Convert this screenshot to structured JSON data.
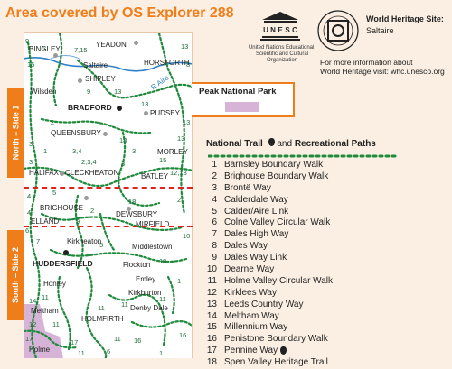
{
  "title": "Area covered by OS Explorer 288",
  "side_tabs": {
    "north": "North – Side 1",
    "south": "South – Side 2"
  },
  "map": {
    "places": [
      {
        "id": "bingley",
        "name": "BINGLEY"
      },
      {
        "id": "yeadon",
        "name": "YEADON"
      },
      {
        "id": "saltaire",
        "name": "Saltaire"
      },
      {
        "id": "horsforth",
        "name": "HORSFORTH"
      },
      {
        "id": "shipley",
        "name": "SHIPLEY"
      },
      {
        "id": "wilsden",
        "name": "Wilsden"
      },
      {
        "id": "river_aire",
        "name": "R Aire"
      },
      {
        "id": "bradford",
        "name": "BRADFORD"
      },
      {
        "id": "pudsey",
        "name": "PUDSEY"
      },
      {
        "id": "queensbury",
        "name": "QUEENSBURY"
      },
      {
        "id": "morley",
        "name": "MORLEY"
      },
      {
        "id": "halifax",
        "name": "HALIFAX"
      },
      {
        "id": "cleckheaton",
        "name": "CLECKHEATON"
      },
      {
        "id": "batley",
        "name": "BATLEY"
      },
      {
        "id": "brighouse",
        "name": "BRIGHOUSE"
      },
      {
        "id": "dewsbury",
        "name": "DEWSBURY"
      },
      {
        "id": "elland",
        "name": "ELLAND"
      },
      {
        "id": "mirfield",
        "name": "MIRFIELD"
      },
      {
        "id": "kirkheaton",
        "name": "Kirkheaton"
      },
      {
        "id": "middlestown",
        "name": "Middlestown"
      },
      {
        "id": "huddersfield",
        "name": "HUDDERSFIELD"
      },
      {
        "id": "flockton",
        "name": "Flockton"
      },
      {
        "id": "emley",
        "name": "Emley"
      },
      {
        "id": "honley",
        "name": "Honley"
      },
      {
        "id": "kirkburton",
        "name": "Kirkburton"
      },
      {
        "id": "denby_dale",
        "name": "Denby Dale"
      },
      {
        "id": "meltham",
        "name": "Meltham"
      },
      {
        "id": "holmfirth",
        "name": "HOLMFIRTH"
      },
      {
        "id": "holme",
        "name": "Holme"
      }
    ],
    "trail_numbers": [
      "9",
      "5",
      "7,15",
      "13",
      "15",
      "9",
      "13",
      "8",
      "13",
      "13",
      "2",
      "13",
      "3",
      "18",
      "3",
      "1",
      "3,4",
      "15",
      "2,3,4",
      "3",
      "3",
      "12,13",
      "4",
      "5",
      "18",
      "2",
      "4",
      "9",
      "6",
      "2",
      "10",
      "7",
      "5",
      "18",
      "11",
      "1",
      "14",
      "12",
      "11",
      "11",
      "11",
      "11",
      "11",
      "16",
      "16",
      "17",
      "6",
      "17",
      "11",
      "6",
      "1"
    ]
  },
  "unesco": {
    "caption": "United Nations Educational, Scientific and Cultural Organization",
    "logo_name": "UNESCO"
  },
  "whs": {
    "title": "World Heritage Site:",
    "site": "Saltaire",
    "more_line1": "For more information about",
    "more_line2": "World Heritage visit: whc.unesco.org"
  },
  "peak": {
    "title": "Peak National Park",
    "swatch_color": "#d7b3d8"
  },
  "trails_heading": {
    "part1": "National Trail",
    "and": "and",
    "part2": "Recreational Paths"
  },
  "trails": [
    {
      "num": "1",
      "name": "Barnsley Boundary Walk",
      "national": false
    },
    {
      "num": "2",
      "name": "Brighouse Boundary Walk",
      "national": false
    },
    {
      "num": "3",
      "name": "Brontë Way",
      "national": false
    },
    {
      "num": "4",
      "name": "Calderdale Way",
      "national": false
    },
    {
      "num": "5",
      "name": "Calder/Aire Link",
      "national": false
    },
    {
      "num": "6",
      "name": "Colne Valley Circular Walk",
      "national": false
    },
    {
      "num": "7",
      "name": "Dales High Way",
      "national": false
    },
    {
      "num": "8",
      "name": "Dales Way",
      "national": false
    },
    {
      "num": "9",
      "name": "Dales Way Link",
      "national": false
    },
    {
      "num": "10",
      "name": "Dearne Way",
      "national": false
    },
    {
      "num": "11",
      "name": "Holme Valley Circular Walk",
      "national": false
    },
    {
      "num": "12",
      "name": "Kirklees Way",
      "national": false
    },
    {
      "num": "13",
      "name": "Leeds Country Way",
      "national": false
    },
    {
      "num": "14",
      "name": "Meltham Way",
      "national": false
    },
    {
      "num": "15",
      "name": "Millennium Way",
      "national": false
    },
    {
      "num": "16",
      "name": "Penistone Boundary Walk",
      "national": false
    },
    {
      "num": "17",
      "name": "Pennine Way",
      "national": true
    },
    {
      "num": "18",
      "name": "Spen Valley Heritage Trail",
      "national": false
    }
  ],
  "colors": {
    "accent_orange": "#ef7d1a",
    "trail_green": "#1f8a3c",
    "sheet_divider_red": "#e3211c",
    "river_blue": "#2f7fc6",
    "peak_lilac": "#d7b3d8"
  }
}
